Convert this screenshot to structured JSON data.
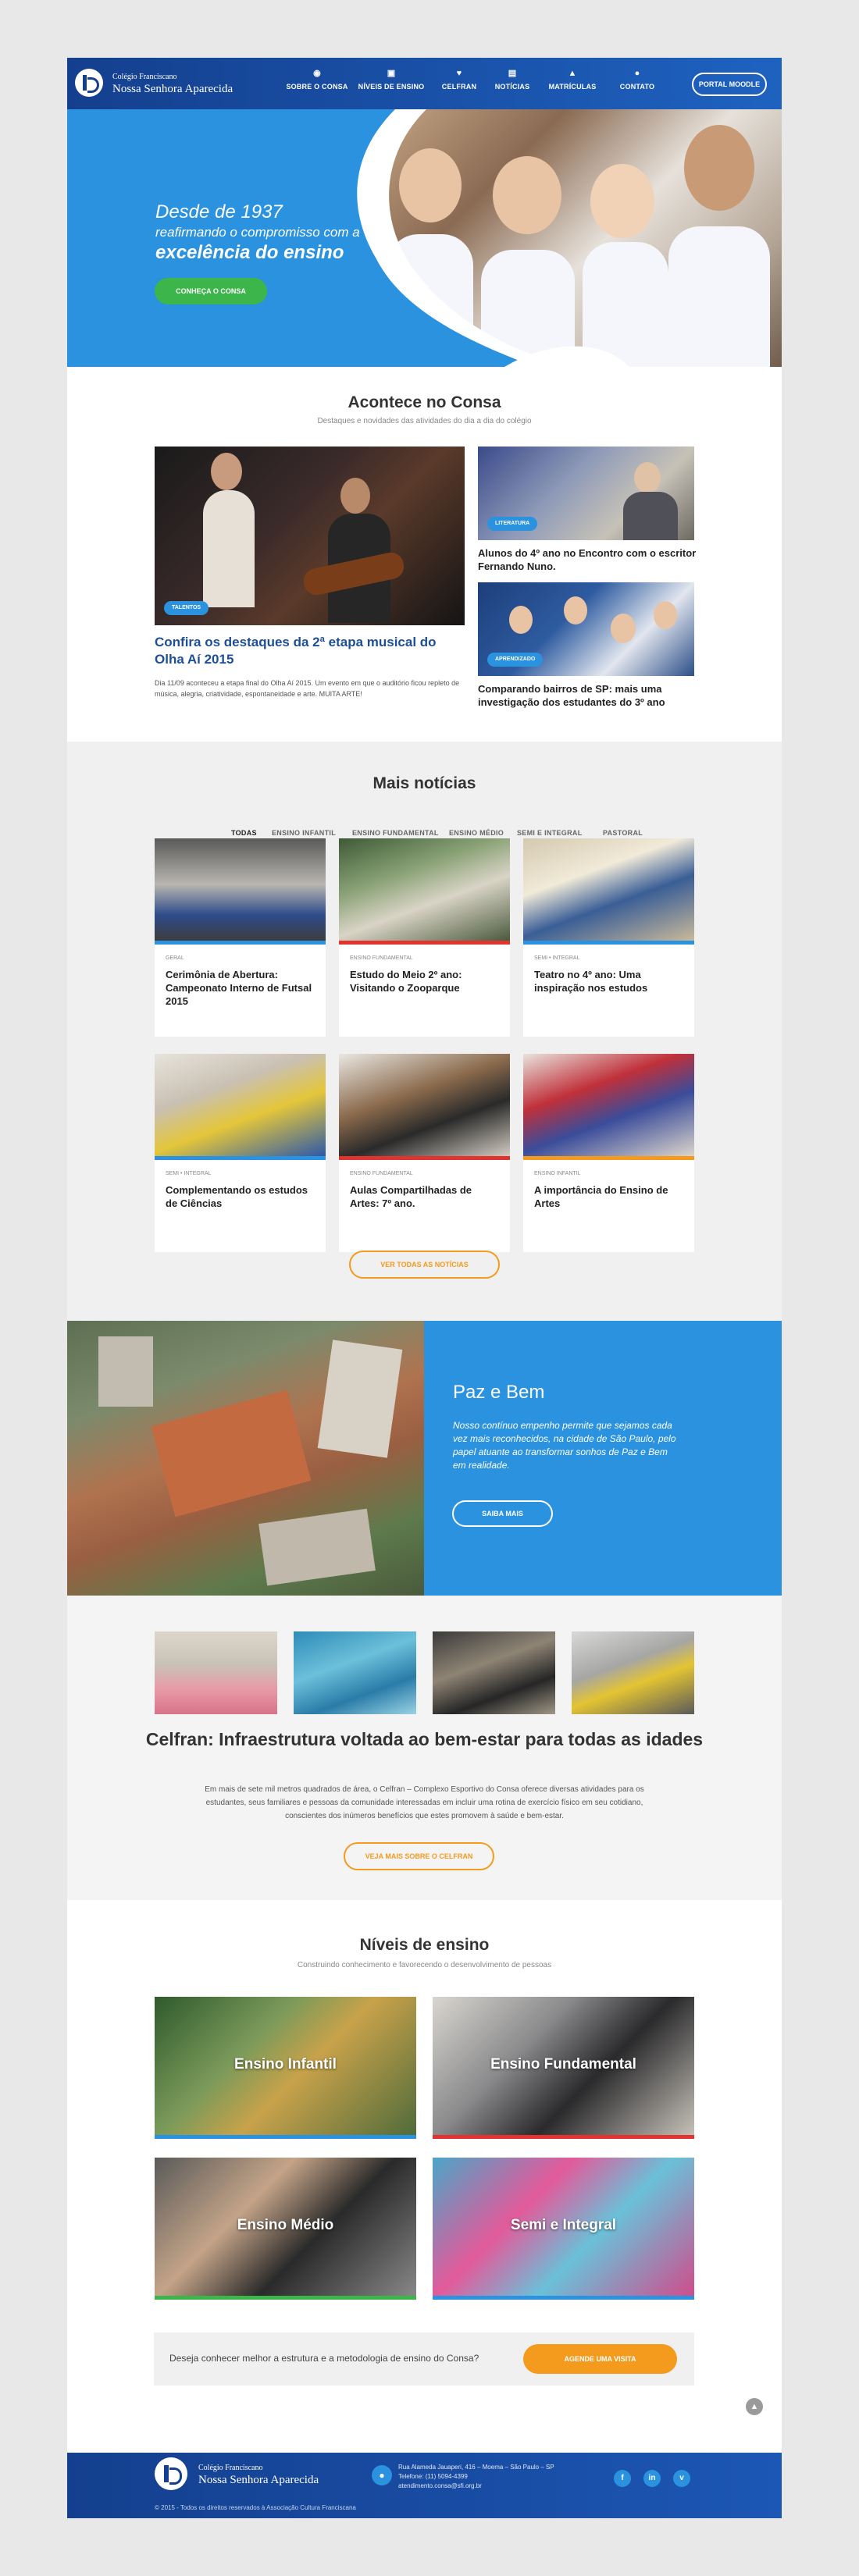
{
  "header": {
    "logo_small": "Colégio Franciscano",
    "logo_big": "Nossa Senhora Aparecida",
    "nav": [
      {
        "label": "SOBRE O CONSA",
        "icon": "globe-icon"
      },
      {
        "label": "NÍVEIS DE ENSINO",
        "icon": "book-icon"
      },
      {
        "label": "CELFRAN",
        "icon": "heart-icon"
      },
      {
        "label": "NOTÍCIAS",
        "icon": "news-icon"
      },
      {
        "label": "MATRÍCULAS",
        "icon": "graduation-cap-icon"
      },
      {
        "label": "CONTATO",
        "icon": "chat-icon"
      }
    ],
    "portal_label": "PORTAL MOODLE"
  },
  "hero": {
    "line1": "Desde de 1937",
    "line2": "reafirmando o compromisso com a",
    "line3": "excelência do ensino",
    "button": "CONHEÇA O CONSA"
  },
  "acontece": {
    "title": "Acontece no Consa",
    "subtitle": "Destaques e novidades das atividades do dia a dia do colégio",
    "feature": {
      "tag": "TALENTOS",
      "title": "Confira os destaques da 2ª etapa musical do Olha Aí 2015",
      "text": "Dia 11/09 aconteceu a etapa final do Olha Aí 2015. Um evento em que o auditório ficou repleto de música, alegria, criatividade, espontaneidade e arte. MUITA ARTE!"
    },
    "side": [
      {
        "tag": "LITERATURA",
        "title": "Alunos do 4º ano no Encontro com o escritor Fernando Nuno."
      },
      {
        "tag": "APRENDIZADO",
        "title": "Comparando bairros de SP: mais uma investigação dos estudantes do 3º ano"
      }
    ]
  },
  "mais": {
    "title": "Mais notícias",
    "tabs": [
      "TODAS",
      "ENSINO INFANTIL",
      "ENSINO FUNDAMENTAL",
      "ENSINO MÉDIO",
      "SEMI E INTEGRAL",
      "PASTORAL"
    ],
    "cards": [
      {
        "cat": "GERAL",
        "title": "Cerimônia de Abertura: Campeonato Interno de Futsal 2015",
        "color": "#2a92df"
      },
      {
        "cat": "ENSINO FUNDAMENTAL",
        "title": "Estudo do Meio 2º ano: Visitando o Zooparque",
        "color": "#e0342f"
      },
      {
        "cat": "SEMI • INTEGRAL",
        "title": "Teatro no 4º ano: Uma inspiração nos estudos",
        "color": "#2a92df"
      },
      {
        "cat": "SEMI • INTEGRAL",
        "title": "Complementando os estudos de Ciências",
        "color": "#2a92df"
      },
      {
        "cat": "ENSINO FUNDAMENTAL",
        "title": "Aulas Compartilhadas de Artes: 7º ano.",
        "color": "#e0342f"
      },
      {
        "cat": "ENSINO INFANTIL",
        "title": "A importância do Ensino de Artes",
        "color": "#f49a1d"
      }
    ],
    "button": "VER TODAS AS NOTÍCIAS"
  },
  "paz": {
    "title": "Paz e Bem",
    "text": "Nosso contínuo empenho permite que sejamos cada vez mais reconhecidos, na cidade de São Paulo, pelo papel atuante ao transformar sonhos de Paz e Bem em realidade.",
    "button": "SAIBA MAIS"
  },
  "celfran": {
    "title": "Celfran: Infraestrutura voltada ao bem-estar para todas as idades",
    "text": "Em mais de sete mil metros quadrados de área, o Celfran – Complexo Esportivo do Consa oferece diversas atividades para os estudantes, seus familiares e pessoas da comunidade interessadas em incluir uma rotina de exercício físico em seu cotidiano, conscientes dos inúmeros benefícios que estes promovem à saúde e bem-estar.",
    "button": "VEJA MAIS SOBRE O CELFRAN"
  },
  "niveis": {
    "title": "Níveis de ensino",
    "subtitle": "Construindo conhecimento e favorecendo o desenvolvimento de pessoas",
    "levels": [
      {
        "label": "Ensino Infantil",
        "color": "#2a92df"
      },
      {
        "label": "Ensino Fundamental",
        "color": "#e0342f"
      },
      {
        "label": "Ensino Médio",
        "color": "#3cb54a"
      },
      {
        "label": "Semi e Integral",
        "color": "#2a92df"
      }
    ],
    "cta_text": "Deseja conhecer melhor a estrutura e a metodologia de ensino do Consa?",
    "cta_button": "AGENDE UMA VISITA"
  },
  "footer": {
    "logo_small": "Colégio Franciscano",
    "logo_big": "Nossa Senhora Aparecida",
    "address": "Rua Alameda Jauaperi, 416 – Moema – São Paulo – SP",
    "phone": "Telefone: (11) 5094-4399",
    "email": "atendimento.consa@sfi.org.br",
    "social": [
      "f",
      "in",
      "v"
    ],
    "copyright": "© 2015 - Todos os direitos reservados à Associação Cultura Franciscana"
  }
}
